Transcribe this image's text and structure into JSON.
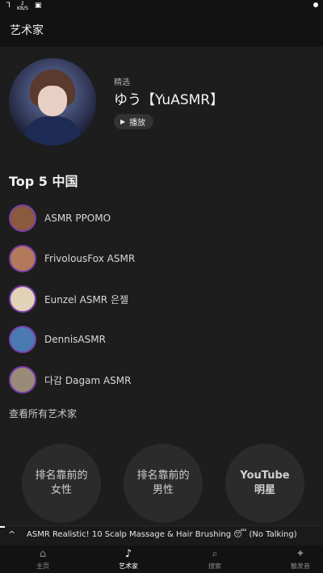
{
  "status_bar": {
    "speed_value": "2",
    "speed_unit": "KB/S"
  },
  "app_bar": {
    "title": "艺术家"
  },
  "featured": {
    "label": "精选",
    "name": "ゆう【YuASMR】",
    "play_label": "播放"
  },
  "top_section": {
    "title": "Top 5 中国"
  },
  "artists": [
    {
      "name": "ASMR PPOMO",
      "avatar_color": "#8a5a3c"
    },
    {
      "name": "FrivolousFox ASMR",
      "avatar_color": "#b27a5a"
    },
    {
      "name": "Eunzel ASMR 은젤",
      "avatar_color": "#e2d2b8"
    },
    {
      "name": "DennisASMR",
      "avatar_color": "#4a7ab2"
    },
    {
      "name": "다감 Dagam ASMR",
      "avatar_color": "#9a8a78"
    }
  ],
  "see_all": "查看所有艺术家",
  "categories": [
    {
      "label": "排名靠前的女性"
    },
    {
      "label": "排名靠前的男性"
    },
    {
      "label": "YouTube明星"
    }
  ],
  "mini_player": {
    "track": "ASMR Realistic! 10 Scalp Massage & Hair Brushing 😴 (No Talking)",
    "progress": 0.015
  },
  "bottom_nav": [
    {
      "label": "主页",
      "icon": "home-icon"
    },
    {
      "label": "艺术家",
      "icon": "artist-icon"
    },
    {
      "label": "搜索",
      "icon": "search-icon"
    },
    {
      "label": "触发音",
      "icon": "sparkle-icon"
    }
  ],
  "accent_color": "#7a3fa8"
}
